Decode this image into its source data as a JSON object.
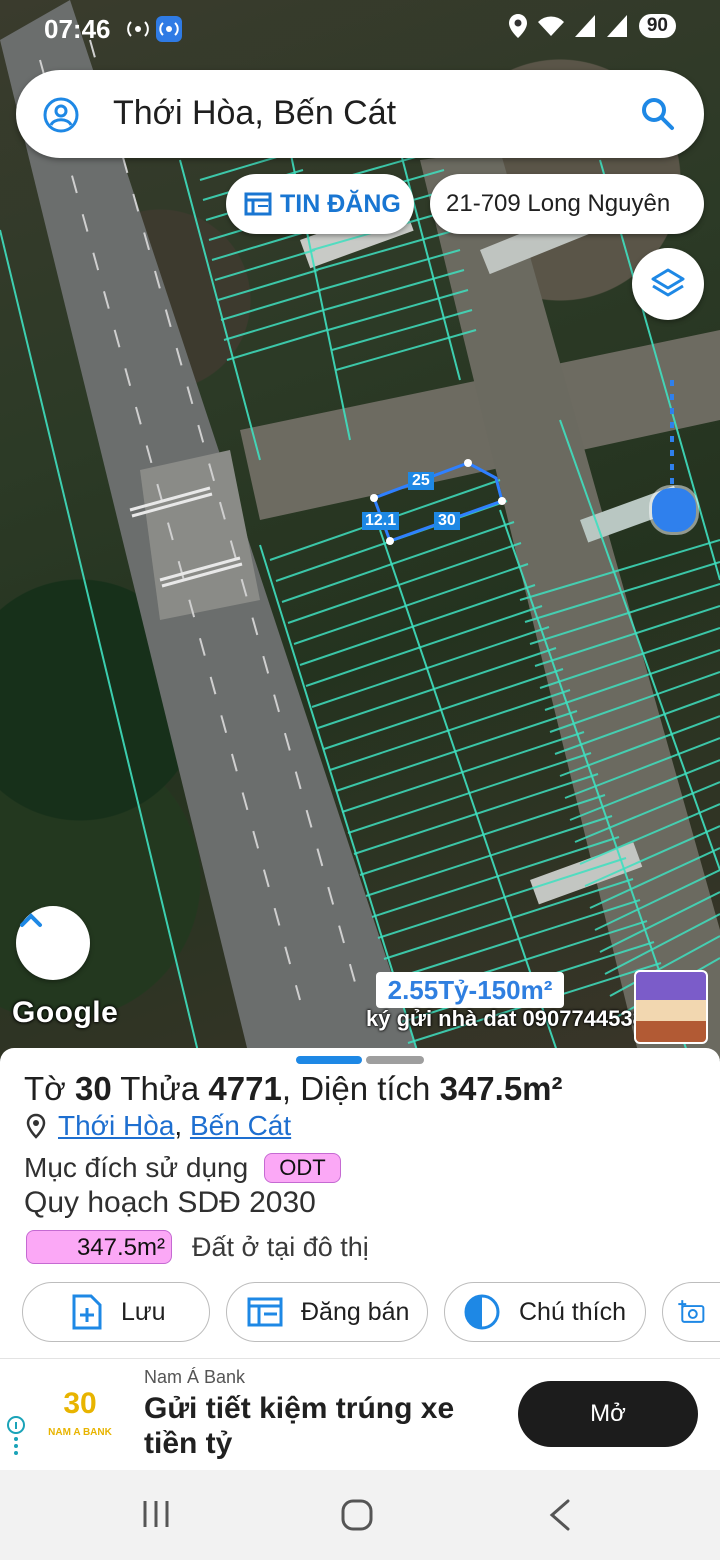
{
  "status_bar": {
    "time": "07:46",
    "battery": "90"
  },
  "search": {
    "title": "Thới Hòa, Bến Cát"
  },
  "chips": {
    "listings": "TIN ĐĂNG",
    "address": "21-709 Long Nguyên"
  },
  "map": {
    "edge_labels": {
      "top": "25",
      "left": "12.1",
      "bottom": "30"
    },
    "attribution": "Google",
    "ad_price": "2.55Tỷ-150m²",
    "ad_text": "ký gửi nhà dat 0907744538"
  },
  "parcel": {
    "sheet_label": "Tờ",
    "sheet_no": "30",
    "lot_label": "Thửa",
    "lot_no": "4771",
    "area_label": "Diện tích",
    "area": "347.5m²",
    "ward": "Thới Hòa",
    "district": "Bến Cát",
    "usage_label": "Mục đích sử dụng",
    "usage_code": "ODT",
    "plan_label": "Quy hoạch SDĐ 2030",
    "plan_area": "347.5m²",
    "plan_desc": "Đất ở tại đô thị"
  },
  "actions": {
    "save": "Lưu",
    "sell": "Đăng bán",
    "legend": "Chú thích"
  },
  "advert": {
    "brand": "Nam Á Bank",
    "headline": "Gửi tiết kiệm trúng xe tiền tỷ",
    "cta": "Mở",
    "logo_text": "NAM A BANK",
    "logo_number": "30"
  },
  "colors": {
    "accent": "#1e88e5",
    "plot_line": "#3fe0c0",
    "pill": "#fba8f6"
  }
}
